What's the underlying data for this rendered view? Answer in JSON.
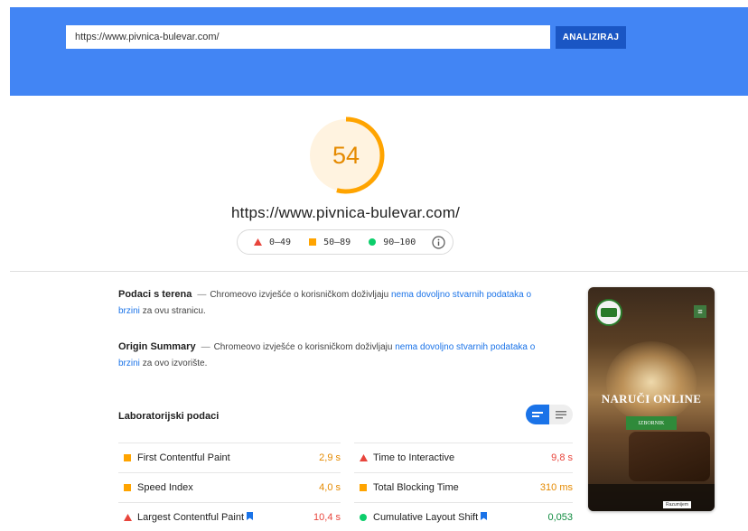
{
  "search": {
    "url_value": "https://www.pivnica-bulevar.com/",
    "analyze_label": "ANALIZIRAJ"
  },
  "summary": {
    "score": "54",
    "score_fraction": 0.54,
    "site_url": "https://www.pivnica-bulevar.com/",
    "legend": [
      "0–49",
      "50–89",
      "90–100"
    ]
  },
  "field_data": {
    "title": "Podaci s terena",
    "pre": "Chromeovo izvješće o korisničkom doživljaju",
    "link": "nema dovoljno stvarnih podataka o brzini",
    "post": "za ovu stranicu."
  },
  "origin_summary": {
    "title": "Origin Summary",
    "pre": "Chromeovo izvješće o korisničkom doživljaju",
    "link": "nema dovoljno stvarnih podataka o brzini",
    "post": "za ovo izvorište."
  },
  "lab": {
    "title": "Laboratorijski podaci",
    "metrics": [
      {
        "name": "First Contentful Paint",
        "value": "2,9 s",
        "status": "average"
      },
      {
        "name": "Time to Interactive",
        "value": "9,8 s",
        "status": "fail"
      },
      {
        "name": "Speed Index",
        "value": "4,0 s",
        "status": "average"
      },
      {
        "name": "Total Blocking Time",
        "value": "310 ms",
        "status": "average"
      },
      {
        "name": "Largest Contentful Paint",
        "value": "10,4 s",
        "status": "fail"
      },
      {
        "name": "Cumulative Layout Shift",
        "value": "0,053",
        "status": "pass"
      }
    ]
  },
  "screenshot": {
    "headline": "NARUČI ONLINE",
    "button": "IZBORNIK",
    "cookie_button": "Razumijem"
  },
  "colors": {
    "header": "#4285f4",
    "button": "#1a56c4",
    "fail": "#e8453c",
    "average": "#e58a00",
    "pass": "#0d8a3e",
    "link": "#1a73e8"
  }
}
